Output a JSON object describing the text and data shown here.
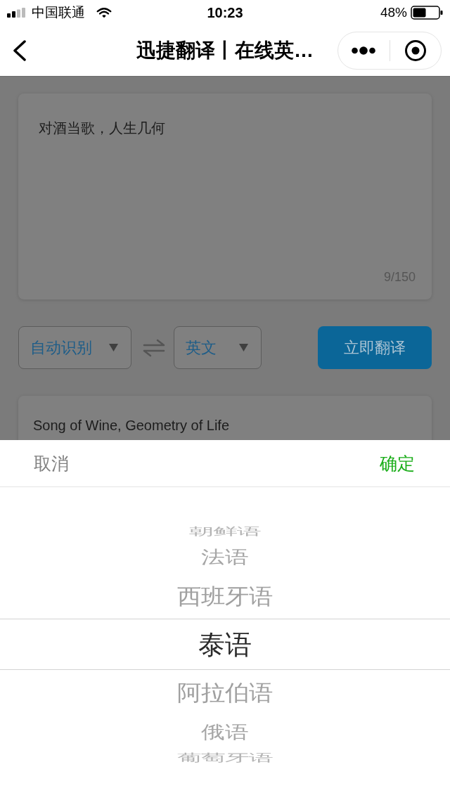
{
  "status_bar": {
    "carrier": "中国联通",
    "time": "10:23",
    "battery": "48%"
  },
  "nav_bar": {
    "title": "迅捷翻译丨在线英…"
  },
  "source_input": {
    "value": "对酒当歌，人生几何",
    "counter": "9/150"
  },
  "language_bar": {
    "source": "自动识别",
    "target": "英文",
    "translate_button": "立即翻译"
  },
  "result": {
    "text": "Song of Wine, Geometry of Life"
  },
  "picker": {
    "cancel": "取消",
    "confirm": "确定",
    "options": [
      {
        "label": "朝鲜语",
        "selected": false
      },
      {
        "label": "法语",
        "selected": false
      },
      {
        "label": "西班牙语",
        "selected": false
      },
      {
        "label": "泰语",
        "selected": true
      },
      {
        "label": "阿拉伯语",
        "selected": false
      },
      {
        "label": "俄语",
        "selected": false
      },
      {
        "label": "葡萄牙语",
        "selected": false
      }
    ]
  }
}
